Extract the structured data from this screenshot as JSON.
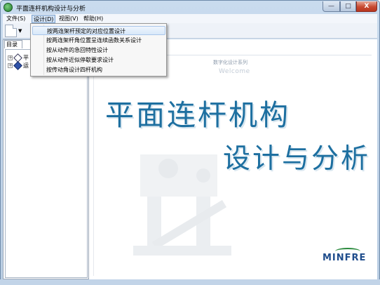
{
  "window": {
    "title": "平面连杆机构设计与分析",
    "min_label": "—",
    "max_label": "□",
    "close_label": "X"
  },
  "menubar": {
    "items": [
      {
        "label": "文件(S)"
      },
      {
        "label": "设计(D)"
      },
      {
        "label": "视图(V)"
      },
      {
        "label": "帮助(H)"
      }
    ],
    "open_index": 1
  },
  "dropdown": {
    "items": [
      {
        "label": "按两连架杆预定的对应位置设计"
      },
      {
        "label": "按两连架杆角位置呈连续函数关系设计"
      },
      {
        "label": "按从动件的急回特性设计"
      },
      {
        "label": "按从动件近似停歇要求设计"
      },
      {
        "label": "按传动角设计四杆机构"
      }
    ],
    "highlighted_index": 0
  },
  "toolbar": {
    "dropdown_arrow": "▼"
  },
  "tree": {
    "tab_label": "目录",
    "nodes": [
      {
        "label": "平"
      },
      {
        "label": "运"
      }
    ]
  },
  "splash": {
    "subtitle": "数字化设计系列",
    "welcome": "Welcome",
    "title_line1": "平面连杆机构",
    "title_line2": "设计与分析",
    "logo": "MINFRE"
  },
  "colors": {
    "accent": "#1d6fa0",
    "logo": "#1f4d8c",
    "menu_highlight": "#d8e8f9"
  }
}
